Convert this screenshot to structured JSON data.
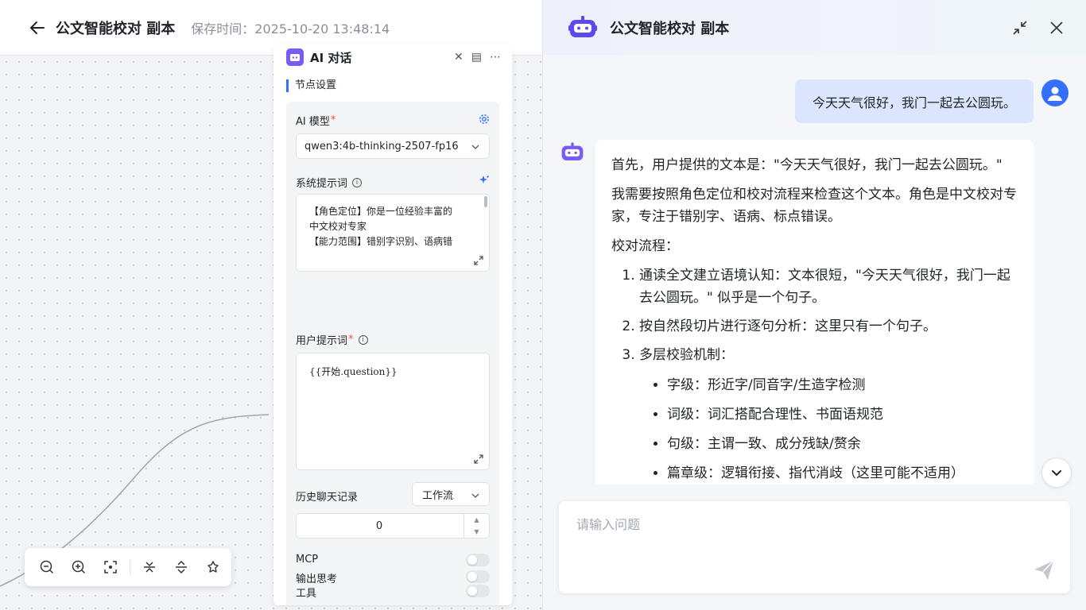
{
  "header": {
    "title": "公文智能校对 副本",
    "save_time": "保存时间：2025-10-20 13:48:14"
  },
  "node": {
    "title": "AI 对话",
    "section": "节点设置",
    "model_label": "AI 模型",
    "model_value": "qwen3:4b-thinking-2507-fp16",
    "system_prompt_label": "系统提示词",
    "system_prompt_lines": [
      "【角色定位】你是一位经验丰富的",
      "中文校对专家",
      "【能力范围】错别字识别、语病错"
    ],
    "user_prompt_label": "用户提示词",
    "user_prompt_value": "{{开始.question}}",
    "history_label": "历史聊天记录",
    "history_select": "工作流",
    "history_count": "0",
    "mcp_label": "MCP",
    "tools_label": "工具",
    "output_thinking_label": "输出思考",
    "required_mark": "*"
  },
  "chat": {
    "title": "公文智能校对 副本",
    "user_message": "今天天气很好，我门一起去公圆玩。",
    "bot_p1": "首先，用户提供的文本是：\"今天天气很好，我门一起去公圆玩。\"",
    "bot_p2": "我需要按照角色定位和校对流程来检查这个文本。角色是中文校对专家，专注于错别字、语病、标点错误。",
    "bot_p3": "校对流程：",
    "steps": [
      "通读全文建立语境认知：文本很短，\"今天天气很好，我门一起去公圆玩。\" 似乎是一个句子。",
      "按自然段切片进行逐句分析：这里只有一个句子。",
      "多层校验机制："
    ],
    "checks": [
      "字级：形近字/同音字/生造字检测",
      "词级：词汇搭配合理性、书面语规范",
      "句级：主谓一致、成分残缺/赘余",
      "篇章级：逻辑衔接、指代消歧（这里可能不适用）"
    ],
    "input_placeholder": "请输入问题"
  },
  "colors": {
    "accent": "#3370ff",
    "bot_purple": "#7a5af8",
    "user_bubble": "#dbe5fd"
  }
}
